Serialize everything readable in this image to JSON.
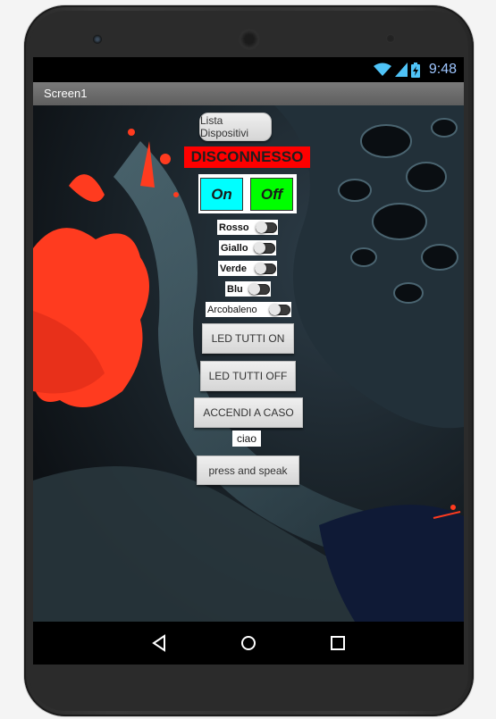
{
  "statusbar": {
    "time": "9:48"
  },
  "screen": {
    "title": "Screen1"
  },
  "buttons": {
    "device_list": "Lista Dispositivi",
    "on": "On",
    "off": "Off",
    "led_all_on": "LED TUTTI ON",
    "led_all_off": "LED TUTTI OFF",
    "random_on": "ACCENDI A CASO",
    "press_speak": "press and speak"
  },
  "connection_status": "DISCONNESSO",
  "switches": [
    {
      "label": "Rosso",
      "checked": false
    },
    {
      "label": "Giallo",
      "checked": false
    },
    {
      "label": "Verde",
      "checked": false
    },
    {
      "label": "Blu",
      "checked": false
    },
    {
      "label": "Arcobaleno",
      "checked": false
    }
  ],
  "text_label": "ciao",
  "colors": {
    "status_bg": "#ff0000",
    "on_bg": "#00ffff",
    "off_bg": "#00ff00",
    "title_bar": "#6b6b6b"
  },
  "icons": {
    "wifi": "wifi-icon",
    "signal": "signal-icon",
    "battery": "battery-icon",
    "back": "back-icon",
    "home": "home-icon",
    "recents": "recents-icon"
  }
}
